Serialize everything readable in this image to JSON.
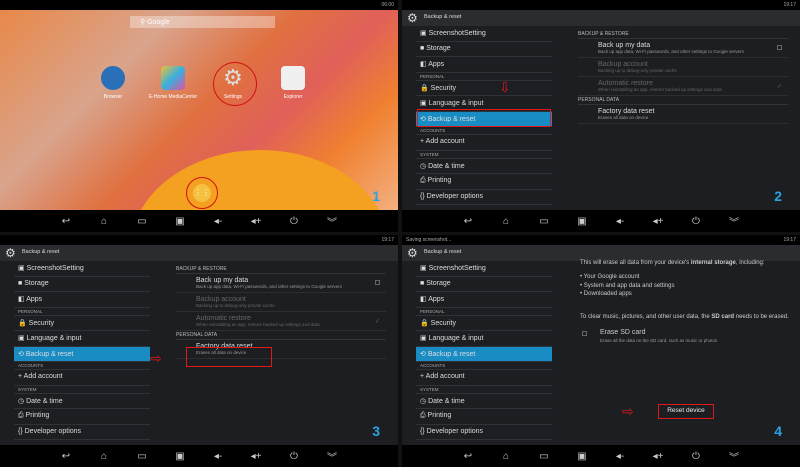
{
  "panel1": {
    "time": "06:00",
    "search_label": "Google",
    "apps": [
      {
        "label": "Browser",
        "color": "#2a70b8"
      },
      {
        "label": "E-Home MediaCenter",
        "color": "#38b0e0"
      },
      {
        "label": "Settings",
        "color": "#999999"
      },
      {
        "label": "Explorer",
        "color": "#f0f0f0"
      }
    ],
    "step": "1"
  },
  "settings": {
    "title": "Backup & reset",
    "time": "19:17",
    "sidebar": [
      {
        "label": "ScreenshotSetting",
        "icon": "▣"
      },
      {
        "label": "Storage",
        "icon": "■"
      },
      {
        "label": "Apps",
        "icon": "◧"
      },
      {
        "label": "PERSONAL",
        "header": true
      },
      {
        "label": "Security",
        "icon": "🔒"
      },
      {
        "label": "Language & input",
        "icon": "▣"
      },
      {
        "label": "Backup & reset",
        "icon": "⟲",
        "selected": true
      },
      {
        "label": "ACCOUNTS",
        "header": true
      },
      {
        "label": "Add account",
        "icon": "+"
      },
      {
        "label": "SYSTEM",
        "header": true
      },
      {
        "label": "Date & time",
        "icon": "◷"
      },
      {
        "label": "Printing",
        "icon": "⎙"
      },
      {
        "label": "Developer options",
        "icon": "{}"
      }
    ],
    "backup_header": "BACKUP & RESTORE",
    "backup_items": [
      {
        "title": "Back up my data",
        "desc": "Back up app data, Wi-Fi passwords, and other settings to Google servers",
        "checkbox": true
      },
      {
        "title": "Backup account",
        "desc": "Backing up to debug-only private cache",
        "dim": true
      },
      {
        "title": "Automatic restore",
        "desc": "When reinstalling an app, restore backed up settings and data",
        "dim": true,
        "check": "✓"
      }
    ],
    "personal_header": "PERSONAL DATA",
    "factory": {
      "title": "Factory data reset",
      "desc": "Erases all data on device"
    }
  },
  "panel2": {
    "step": "2"
  },
  "panel3": {
    "step": "3"
  },
  "panel4": {
    "status": "Saving screenshot...",
    "intro": "This will erase all data from your device's ",
    "intro_bold": "internal storage",
    "intro_end": ", including:",
    "bullets": [
      "• Your Google account",
      "• System and app data and settings",
      "• Downloaded apps"
    ],
    "sd_text": "To clear music, pictures, and other user data, the ",
    "sd_bold": "SD card",
    "sd_end": " needs to be erased.",
    "erase_title": "Erase SD card",
    "erase_desc": "Erase all the data on the SD card, such as music or photos",
    "reset_button": "Reset device",
    "step": "4"
  },
  "navbar": [
    "↩",
    "⌂",
    "▭",
    "▣",
    "◂-",
    "◂+",
    "⏻",
    "︾"
  ]
}
